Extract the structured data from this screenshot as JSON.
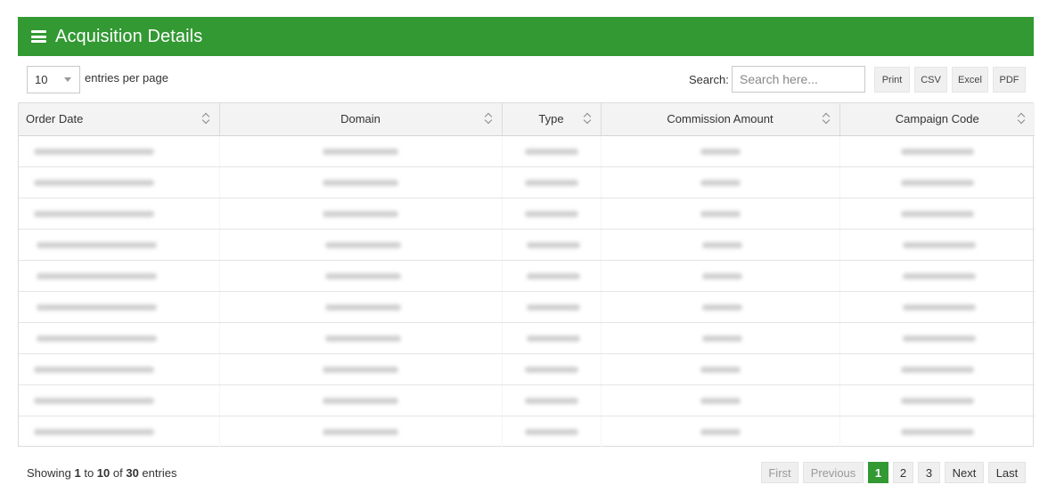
{
  "header": {
    "title": "Acquisition Details",
    "menu_icon": "hamburger-icon"
  },
  "length": {
    "value": "10",
    "label": "entries per page"
  },
  "search": {
    "label": "Search:",
    "placeholder": "Search here..."
  },
  "export_buttons": [
    "Print",
    "CSV",
    "Excel",
    "PDF"
  ],
  "table": {
    "columns": [
      "Order Date",
      "Domain",
      "Type",
      "Commission Amount",
      "Campaign Code"
    ],
    "row_count": 10,
    "cells_redacted": true
  },
  "footer": {
    "info_prefix": "Showing ",
    "start": "1",
    "to": " to ",
    "end": "10",
    "of": " of ",
    "total": "30",
    "suffix": " entries"
  },
  "pagination": {
    "first": "First",
    "previous": "Previous",
    "pages": [
      "1",
      "2",
      "3"
    ],
    "current": "1",
    "next": "Next",
    "last": "Last"
  },
  "colors": {
    "accent": "#339933",
    "header_bg": "#f3f3f3",
    "button_bg": "#f0f0f0"
  }
}
